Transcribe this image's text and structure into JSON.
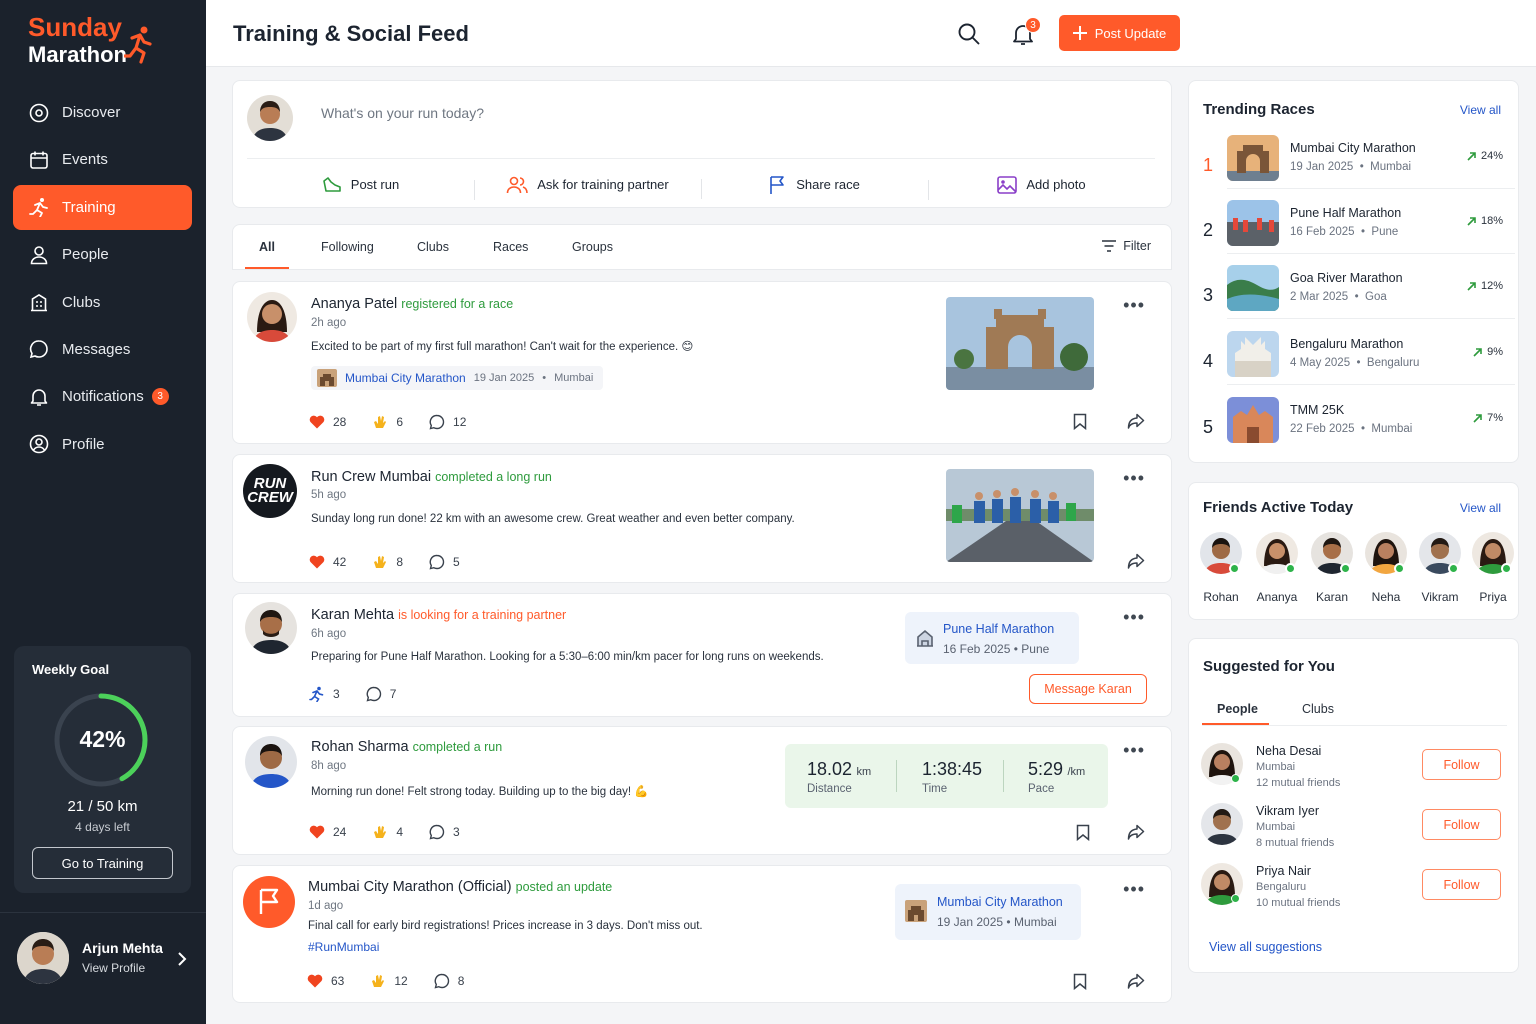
{
  "brand": {
    "line1": "Sunday",
    "line2": "Marathon",
    "accent": "#ff5a2a"
  },
  "nav": [
    {
      "label": "Discover",
      "icon": "compass-icon"
    },
    {
      "label": "Events",
      "icon": "calendar-icon"
    },
    {
      "label": "Training",
      "icon": "runner-icon",
      "active": true
    },
    {
      "label": "People",
      "icon": "person-icon"
    },
    {
      "label": "Clubs",
      "icon": "building-icon"
    },
    {
      "label": "Messages",
      "icon": "chat-bubble-icon"
    },
    {
      "label": "Notifications",
      "icon": "bell-icon",
      "badge": "3"
    },
    {
      "label": "Profile",
      "icon": "user-circle-icon"
    }
  ],
  "goal": {
    "title": "Weekly Goal",
    "percent": "42%",
    "fraction": 0.42,
    "distance": "21 / 50 km",
    "days_left": "4 days left",
    "button": "Go to Training"
  },
  "user": {
    "name": "Arjun Mehta",
    "link": "View Profile"
  },
  "header": {
    "title": "Training & Social Feed",
    "bell_badge": "3",
    "post_button": "Post Update"
  },
  "composer": {
    "placeholder": "What's on your run today?",
    "actions": [
      {
        "label": "Post run",
        "icon": "shoe-icon"
      },
      {
        "label": "Ask for training partner",
        "icon": "people-icon"
      },
      {
        "label": "Share race",
        "icon": "flag-icon"
      },
      {
        "label": "Add photo",
        "icon": "image-icon"
      }
    ]
  },
  "feed_tabs": [
    "All",
    "Following",
    "Clubs",
    "Races",
    "Groups"
  ],
  "filter_label": "Filter",
  "posts": [
    {
      "author": "Ananya Patel",
      "action": "registered for a race",
      "time": "2h ago",
      "text": "Excited to be part of my first full marathon! Can't wait for the experience. 😊",
      "race_tag": {
        "name": "Mumbai City Marathon",
        "date": "19 Jan 2025",
        "city": "Mumbai"
      },
      "likes": "28",
      "claps": "6",
      "comments": "12"
    },
    {
      "author": "Run Crew Mumbai",
      "action": "completed a long run",
      "time": "5h ago",
      "text": "Sunday long run done! 22 km with an awesome crew. Great weather and even better company.",
      "logo_l1": "RUN",
      "logo_l2": "CREW",
      "likes": "42",
      "claps": "8",
      "comments": "5"
    },
    {
      "author": "Karan Mehta",
      "action": "is looking for a training partner",
      "time": "6h ago",
      "text": "Preparing for Pune Half Marathon. Looking for a 5:30–6:00 min/km pacer for long runs on weekends.",
      "race": {
        "name": "Pune Half Marathon",
        "date": "16 Feb 2025",
        "city": "Pune"
      },
      "runners": "3",
      "comments": "7",
      "button": "Message Karan"
    },
    {
      "author": "Rohan Sharma",
      "action": "completed a run",
      "time": "8h ago",
      "text": "Morning run done! Felt strong today. Building up to the big day! 💪",
      "stats": [
        {
          "value": "18.02",
          "unit": "km",
          "label": "Distance"
        },
        {
          "value": "1:38:45",
          "unit": "",
          "label": "Time"
        },
        {
          "value": "5:29",
          "unit": "/km",
          "label": "Pace"
        }
      ],
      "likes": "24",
      "claps": "4",
      "comments": "3"
    },
    {
      "author": "Mumbai City Marathon (Official)",
      "action": "posted an update",
      "time": "1d ago",
      "text": "Final call for early bird registrations! Prices increase in 3 days. Don't miss out.",
      "hashtag": "#RunMumbai",
      "race": {
        "name": "Mumbai City Marathon",
        "date": "19 Jan 2025",
        "city": "Mumbai"
      },
      "likes": "63",
      "claps": "12",
      "comments": "8"
    }
  ],
  "trending": {
    "title": "Trending Races",
    "view_all": "View all",
    "items": [
      {
        "rank": "1",
        "name": "Mumbai City Marathon",
        "date": "19 Jan 2025",
        "city": "Mumbai",
        "pct": "24%"
      },
      {
        "rank": "2",
        "name": "Pune Half Marathon",
        "date": "16 Feb 2025",
        "city": "Pune",
        "pct": "18%"
      },
      {
        "rank": "3",
        "name": "Goa River Marathon",
        "date": "2 Mar 2025",
        "city": "Goa",
        "pct": "12%"
      },
      {
        "rank": "4",
        "name": "Bengaluru Marathon",
        "date": "4 May 2025",
        "city": "Bengaluru",
        "pct": "9%"
      },
      {
        "rank": "5",
        "name": "TMM 25K",
        "date": "22 Feb 2025",
        "city": "Mumbai",
        "pct": "7%"
      }
    ]
  },
  "friends": {
    "title": "Friends Active Today",
    "view_all": "View all",
    "items": [
      "Rohan",
      "Ananya",
      "Karan",
      "Neha",
      "Vikram",
      "Priya"
    ]
  },
  "suggested": {
    "title": "Suggested for You",
    "tabs": [
      "People",
      "Clubs"
    ],
    "items": [
      {
        "name": "Neha Desai",
        "city": "Mumbai",
        "mutual": "12 mutual friends",
        "button": "Follow"
      },
      {
        "name": "Vikram Iyer",
        "city": "Mumbai",
        "mutual": "8 mutual friends",
        "button": "Follow"
      },
      {
        "name": "Priya Nair",
        "city": "Bengaluru",
        "mutual": "10 mutual friends",
        "button": "Follow"
      }
    ],
    "view_all": "View all suggestions"
  }
}
